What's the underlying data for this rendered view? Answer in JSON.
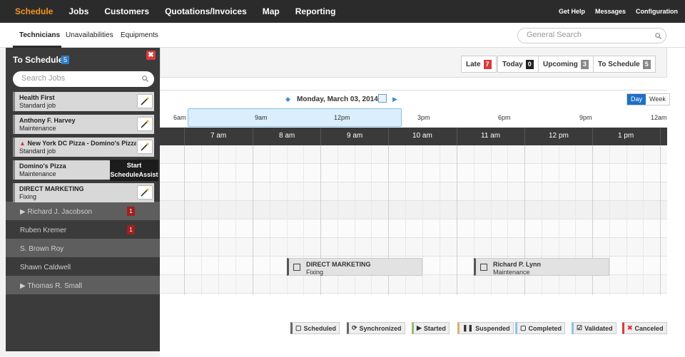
{
  "topnav": {
    "items": [
      "Schedule",
      "Jobs",
      "Customers",
      "Quotations/Invoices",
      "Map",
      "Reporting"
    ],
    "right": [
      "Get Help",
      "Messages",
      "Configuration"
    ]
  },
  "subnav": {
    "tabs": [
      "Technicians",
      "Unavailabilities",
      "Equipments"
    ],
    "search_placeholder": "General Search"
  },
  "filters": [
    {
      "label": "Late",
      "count": "7",
      "color": "#d63c3c"
    },
    {
      "label": "Today",
      "count": "0",
      "color": "#222222"
    },
    {
      "label": "Upcoming",
      "count": "3",
      "color": "#888888"
    },
    {
      "label": "To Schedule",
      "count": "5",
      "color": "#888888"
    }
  ],
  "date": {
    "label": "Monday, March 03, 2014",
    "view_day": "Day",
    "view_week": "Week"
  },
  "range_labels": [
    "6am",
    "9am",
    "12pm",
    "3pm",
    "6pm",
    "9pm",
    "12am"
  ],
  "hour_labels": [
    "7 am",
    "8 am",
    "9 am",
    "10 am",
    "11 am",
    "12 pm",
    "1 pm"
  ],
  "technicians": [
    {
      "name": "Richard J. Jacobson",
      "count": "1",
      "expand": "▶"
    },
    {
      "name": "Ruben Kremer",
      "count": "1",
      "expand": ""
    },
    {
      "name": "S. Brown Roy",
      "count": "",
      "expand": ""
    },
    {
      "name": "Shawn Caldwell",
      "count": "",
      "expand": ""
    },
    {
      "name": "Thomas R. Small",
      "count": "",
      "expand": "▶"
    }
  ],
  "events": [
    {
      "title": "DIRECT MARKETING",
      "sub": "Fixing"
    },
    {
      "title": "Richard P. Lynn",
      "sub": "Maintenance"
    }
  ],
  "panel": {
    "title": "To Schedule",
    "count": "5",
    "search_placeholder": "Search Jobs",
    "tooltip_line1": "Start",
    "tooltip_line2": "ScheduleAssist",
    "jobs": [
      {
        "title": "Health First",
        "sub": "Standard job",
        "warn": ""
      },
      {
        "title": "Anthony F. Harvey",
        "sub": "Maintenance",
        "warn": ""
      },
      {
        "title": "New York DC Pizza - Domino's Pizza",
        "sub": "Standard job",
        "warn": "▲"
      },
      {
        "title": "Domino's Pizza",
        "sub": "Maintenance",
        "warn": ""
      },
      {
        "title": "DIRECT MARKETING",
        "sub": "Fixing",
        "warn": ""
      }
    ]
  },
  "legend": [
    {
      "label": "Scheduled",
      "glyph": "▢",
      "color": "#666666"
    },
    {
      "label": "Synchronized",
      "glyph": "⟳",
      "color": "#666666"
    },
    {
      "label": "Started",
      "glyph": "▶",
      "color": "#8cc06a"
    },
    {
      "label": "Suspended",
      "glyph": "❚❚",
      "color": "#d9b36a"
    },
    {
      "label": "Completed",
      "glyph": "▢",
      "color": "#8ec1e6"
    },
    {
      "label": "Validated",
      "glyph": "☑",
      "color": "#8ec1e6"
    },
    {
      "label": "Canceled",
      "glyph": "✖",
      "color": "#d63c3c"
    }
  ]
}
